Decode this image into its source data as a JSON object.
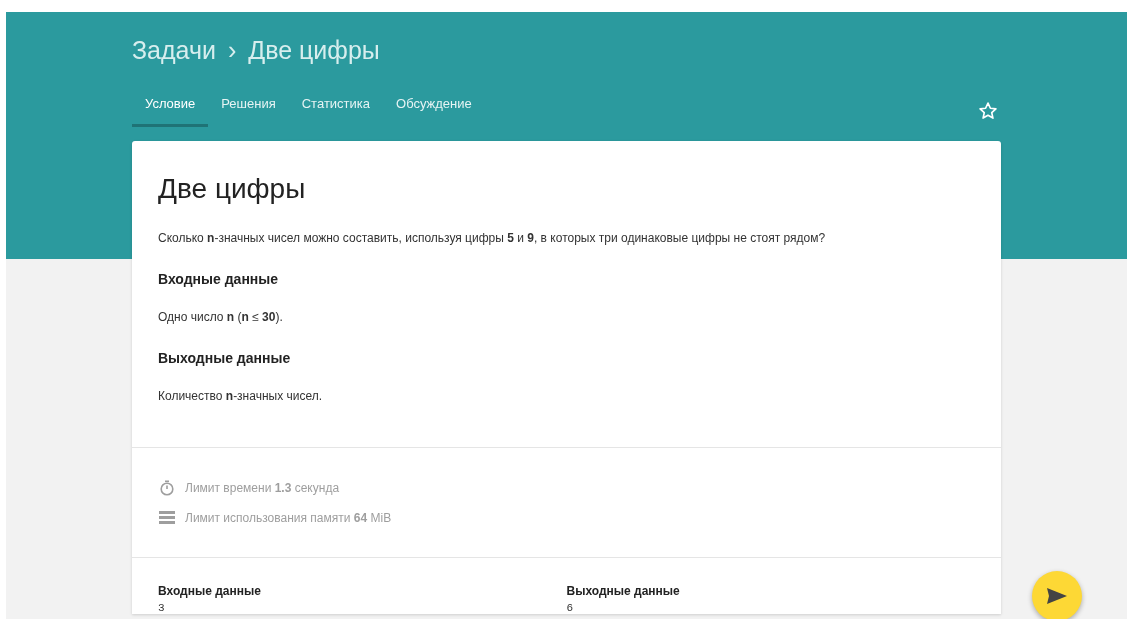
{
  "breadcrumb": {
    "parent": "Задачи",
    "separator": "›",
    "current": "Две цифры"
  },
  "tabs": [
    {
      "label": "Условие",
      "selected": true
    },
    {
      "label": "Решения",
      "selected": false
    },
    {
      "label": "Статистика",
      "selected": false
    },
    {
      "label": "Обсуждение",
      "selected": false
    }
  ],
  "favorite": {
    "starred": false
  },
  "problem": {
    "title": "Две цифры",
    "statement": "Сколько **n**-значных чисел можно составить, используя цифры **5** и **9**, в которых три одинаковые цифры не стоят рядом?",
    "sections": [
      {
        "heading": "Входные данные",
        "text": "Одно число **n** (**n** ≤ **30**)."
      },
      {
        "heading": "Выходные данные",
        "text": "Количество **n**-значных чисел."
      }
    ]
  },
  "limits": [
    {
      "kind": "time",
      "text": "Лимит времени **1.3** секунда"
    },
    {
      "kind": "memory",
      "text": "Лимит использования памяти **64** MiB"
    }
  ],
  "examples": [
    {
      "heading": "Входные данные",
      "value": "3"
    },
    {
      "heading": "Выходные данные",
      "value": "6"
    }
  ]
}
